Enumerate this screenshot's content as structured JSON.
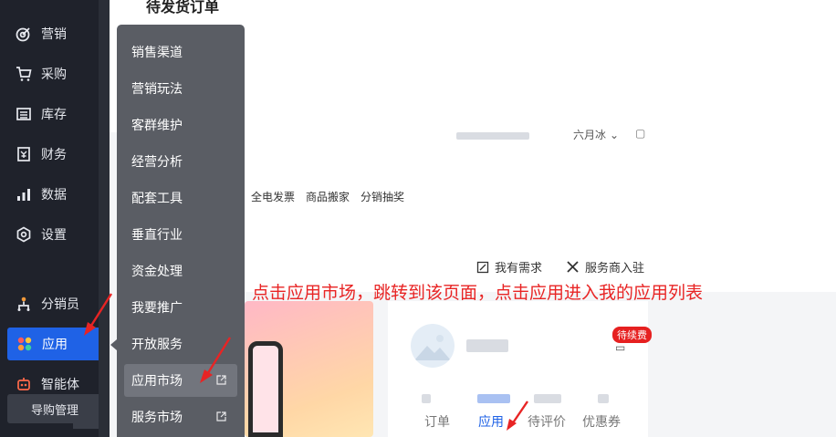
{
  "page": {
    "title": "待发货订单"
  },
  "sidebar": {
    "items": [
      {
        "label": "营销",
        "icon": "target-icon"
      },
      {
        "label": "采购",
        "icon": "cart-icon"
      },
      {
        "label": "库存",
        "icon": "warehouse-icon"
      },
      {
        "label": "财务",
        "icon": "finance-icon"
      },
      {
        "label": "数据",
        "icon": "bar-chart-icon"
      },
      {
        "label": "设置",
        "icon": "gear-icon"
      },
      {
        "label": "分销员",
        "icon": "distribution-icon"
      },
      {
        "label": "应用",
        "icon": "apps-icon"
      },
      {
        "label": "智能体",
        "icon": "robot-icon"
      }
    ],
    "guide_label": "导购管理"
  },
  "dropdown": {
    "items": [
      {
        "label": "销售渠道"
      },
      {
        "label": "营销玩法"
      },
      {
        "label": "客群维护"
      },
      {
        "label": "经营分析"
      },
      {
        "label": "配套工具"
      },
      {
        "label": "垂直行业"
      },
      {
        "label": "资金处理"
      },
      {
        "label": "我要推广"
      },
      {
        "label": "开放服务"
      },
      {
        "label": "应用市场"
      },
      {
        "label": "服务市场"
      }
    ]
  },
  "header": {
    "month_label": "六月冰"
  },
  "quick_links": [
    "全电发票",
    "商品搬家",
    "分销抽奖"
  ],
  "actions": {
    "need_label": "我有需求",
    "partner_label": "服务商入驻"
  },
  "annotation": "点击应用市场，跳转到该页面，点击应用进入我的应用列表",
  "user_card": {
    "badge": "待续费",
    "stats": [
      "订单",
      "应用",
      "待评价",
      "优惠券"
    ]
  },
  "colors": {
    "sidebar_bg": "#1f222b",
    "active_blue": "#1f62e6",
    "dropdown_bg": "#5a5d64",
    "annotation_red": "#e82424"
  }
}
